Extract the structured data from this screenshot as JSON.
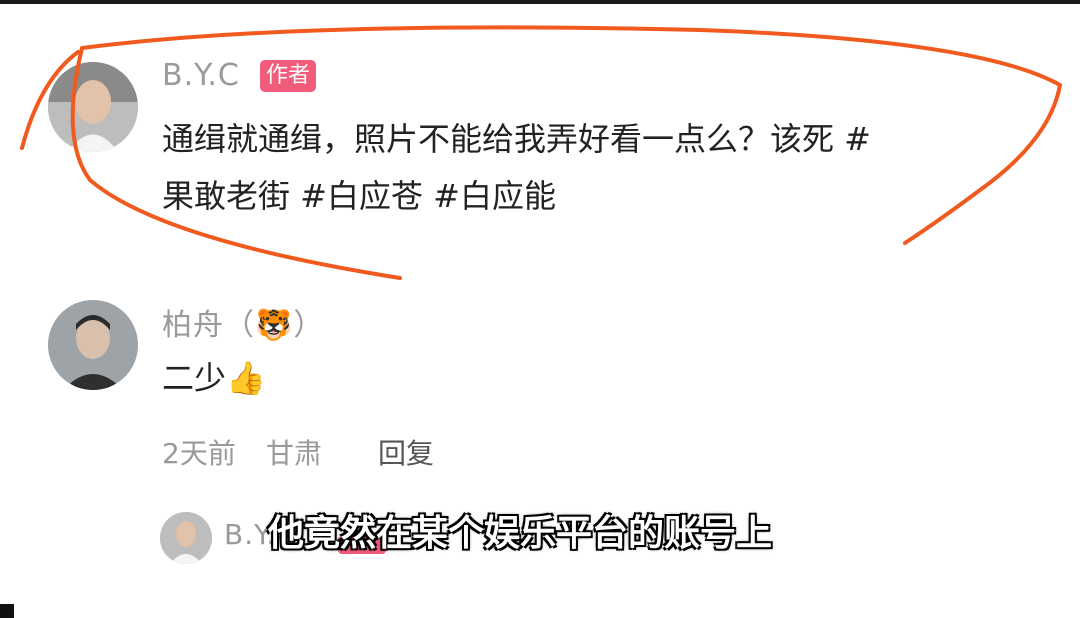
{
  "post": {
    "username": "B.Y.C",
    "badge": "作者",
    "line1": "通缉就通缉，照片不能给我弄好看一点么？该死 #",
    "line2": "果敢老街 #白应苍 #白应能"
  },
  "reply": {
    "username": "柏舟（🐯）",
    "text": "二少👍",
    "time": "2天前",
    "location": "甘肃",
    "reply_label": "回复"
  },
  "next_comment": {
    "username": "B.Y.C"
  },
  "video_subtitle": "他竟然在某个娱乐平台的账号上",
  "annotation_color": "#f05a1e",
  "badge_color": "#f25c7b"
}
